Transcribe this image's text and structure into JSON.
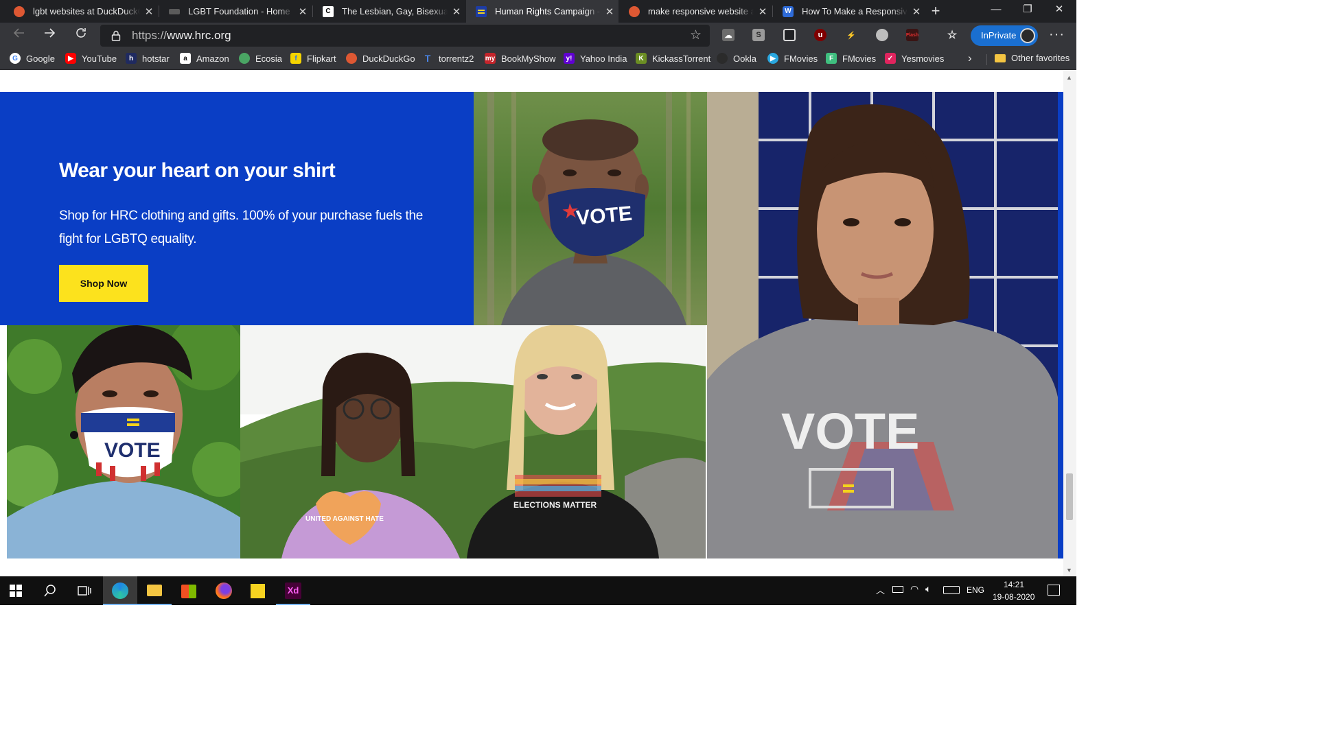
{
  "browser": {
    "tabs": [
      {
        "title": "lgbt websites at DuckDuckGo",
        "icon": "duckduckgo-icon",
        "active": false,
        "icon_color": "#de5833"
      },
      {
        "title": "LGBT Foundation - Home",
        "icon": "lgbt-foundation-icon",
        "active": false,
        "icon_color": "#6a6a6a"
      },
      {
        "title": "The Lesbian, Gay, Bisexual &",
        "icon": "c-icon",
        "active": false,
        "icon_color": "#ffffff"
      },
      {
        "title": "Human Rights Campaign - H",
        "icon": "hrc-icon",
        "active": true,
        "icon_color": "#f4d31c"
      },
      {
        "title": "make responsive website at",
        "icon": "duckduckgo-icon",
        "active": false,
        "icon_color": "#de5833"
      },
      {
        "title": "How To Make a Responsive",
        "icon": "wolf-icon",
        "active": false,
        "icon_color": "#2e6bd8"
      }
    ],
    "new_tab_symbol": "+",
    "window_controls": {
      "minimize": "—",
      "restore": "❐",
      "close": "✕"
    },
    "address": {
      "url_prefix": "https://",
      "url_host": "www.hrc.org"
    },
    "inprivate_label": "InPrivate",
    "more_symbol": "···",
    "favorites": [
      {
        "label": "Google",
        "icon": "google-icon",
        "color": "#ffffff"
      },
      {
        "label": "YouTube",
        "icon": "youtube-icon",
        "color": "#ff0000"
      },
      {
        "label": "hotstar",
        "icon": "hotstar-icon",
        "color": "#1f2a60"
      },
      {
        "label": "Amazon",
        "icon": "amazon-icon",
        "color": "#ffffff"
      },
      {
        "label": "Ecosia",
        "icon": "ecosia-icon",
        "color": "#4aa564"
      },
      {
        "label": "Flipkart",
        "icon": "flipkart-icon",
        "color": "#f5d400"
      },
      {
        "label": "DuckDuckGo",
        "icon": "duckduckgo-icon",
        "color": "#de5833"
      },
      {
        "label": "torrentz2",
        "icon": "torrentz-icon",
        "color": "#2a5fb0"
      },
      {
        "label": "BookMyShow",
        "icon": "bookmyshow-icon",
        "color": "#c4242b"
      },
      {
        "label": "Yahoo India",
        "icon": "yahoo-icon",
        "color": "#6001d2"
      },
      {
        "label": "KickassTorrent",
        "icon": "kickass-icon",
        "color": "#6b8e23"
      },
      {
        "label": "Ookla",
        "icon": "ookla-icon",
        "color": "#2b2b2b"
      },
      {
        "label": "FMovies",
        "icon": "fmovies-play-icon",
        "color": "#2aa7df"
      },
      {
        "label": "FMovies",
        "icon": "fmovies-f-icon",
        "color": "#3fbf7f"
      },
      {
        "label": "Yesmovies",
        "icon": "yesmovies-icon",
        "color": "#e0245e"
      }
    ],
    "other_favorites": "Other favorites"
  },
  "page": {
    "promo": {
      "title": "Wear your heart on your shirt",
      "subtitle": "Shop for HRC clothing and gifts. 100% of your purchase fuels the fight for LGBTQ equality.",
      "button": "Shop Now"
    },
    "photos": {
      "mask_man_text": "VOTE",
      "mask_youth_text": "VOTE",
      "shirt_woman_text": "VOTE",
      "shirt_black_text": "ELECTIONS MATTER",
      "shirt_pink_text": "UNITED AGAINST HATE"
    },
    "colors": {
      "hrc_blue": "#0a3ec5",
      "hrc_yellow": "#fce21d"
    }
  },
  "taskbar": {
    "language": "ENG",
    "time": "14:21",
    "date": "19-08-2020",
    "xd_label": "Xd"
  }
}
